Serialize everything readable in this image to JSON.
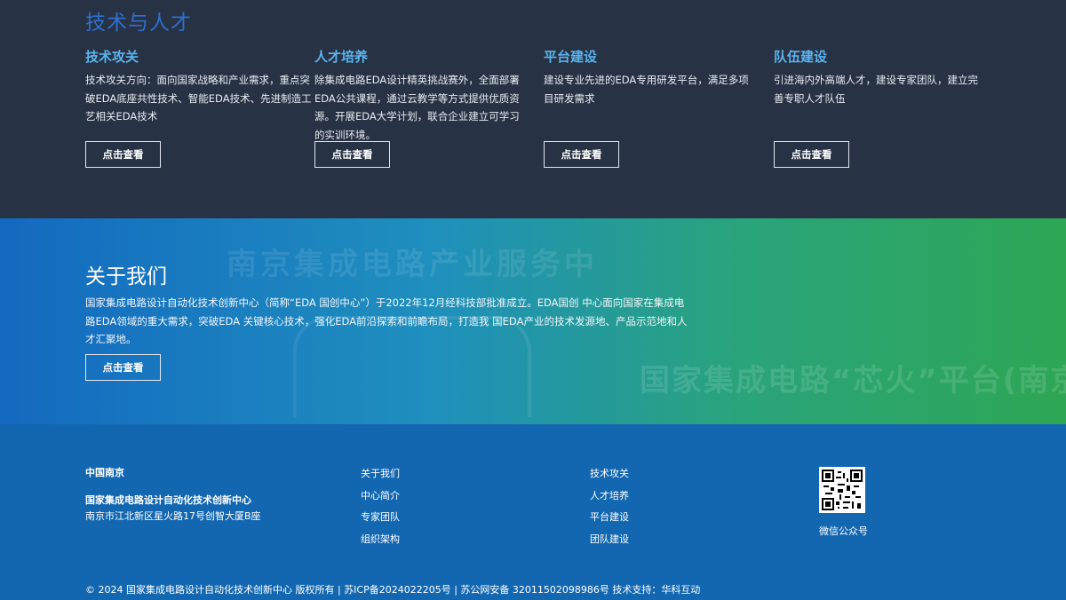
{
  "tech_section": {
    "title": "技术与人才",
    "cards": [
      {
        "title": "技术攻关",
        "text": "技术攻关方向：面向国家战略和产业需求，重点突破EDA底座共性技术、智能EDA技术、先进制造工艺相关EDA技术",
        "button": "点击查看"
      },
      {
        "title": "人才培养",
        "text": "除集成电路EDA设计精英挑战赛外，全面部署EDA公共课程，通过云教学等方式提供优质资源。开展EDA大学计划，联合企业建立可学习的实训环境。",
        "button": "点击查看"
      },
      {
        "title": "平台建设",
        "text": "建设专业先进的EDA专用研发平台，满足多项目研发需求",
        "button": "点击查看"
      },
      {
        "title": "队伍建设",
        "text": "引进海内外高端人才，建设专家团队，建立完善专职人才队伍",
        "button": "点击查看"
      }
    ]
  },
  "about": {
    "title": "关于我们",
    "text": "国家集成电路设计自动化技术创新中心（简称“EDA 国创中心”）于2022年12月经科技部批准成立。EDA国创 中心面向国家在集成电路EDA领域的重大需求，突破EDA 关键核心技术，强化EDA前沿探索和前瞻布局，打造我 国EDA产业的技术发源地、产品示范地和人才汇聚地。",
    "button": "点击查看",
    "background_text_1": "南京集成电路产业服务中",
    "background_text_2": "国家集成电路“芯火”平台(南京"
  },
  "footer": {
    "heading": "中国南京",
    "org_name": "国家集成电路设计自动化技术创新中心",
    "address": "南京市江北新区星火路17号创智大厦B座",
    "links_col1": [
      "关于我们",
      "中心简介",
      "专家团队",
      "组织架构"
    ],
    "links_col2": [
      "技术攻关",
      "人才培养",
      "平台建设",
      "团队建设"
    ],
    "qr_label": "微信公众号",
    "copyright": "© 2024 国家集成电路设计自动化技术创新中心 版权所有 | 苏ICP备2024022205号 | 苏公网安备 32011502098986号 技术支持：华科互动"
  },
  "colors": {
    "tech_bg": "#273244",
    "tech_title": "#2f6fd0",
    "card_title": "#5ab4ee",
    "footer_bg": "#1367b1"
  },
  "icons": {
    "qr": "qr-code-icon"
  }
}
